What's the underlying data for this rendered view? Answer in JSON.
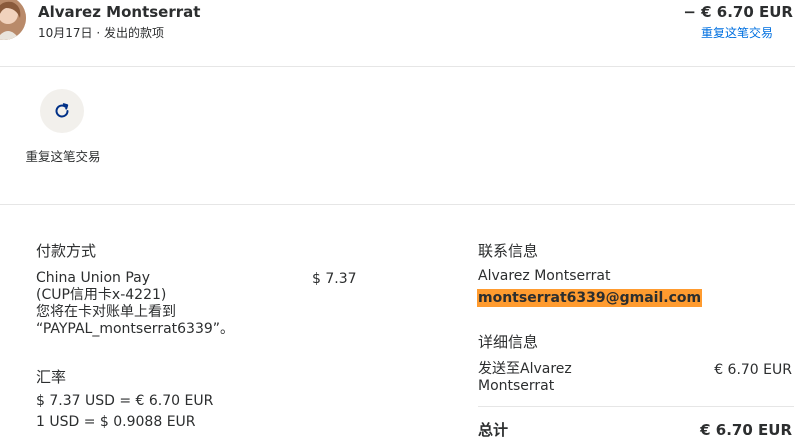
{
  "header": {
    "payee": "Alvarez Montserrat",
    "date_type": "10月17日 · 发出的款项",
    "amount": "− € 6.70 EUR",
    "repeat_link": "重复这笔交易"
  },
  "actions": {
    "repeat_label": "重复这笔交易"
  },
  "payment": {
    "heading": "付款方式",
    "method_lines": [
      "China Union Pay",
      "(CUP信用卡x-4221)",
      "您将在卡对账单上看到",
      "“PAYPAL_montserrat6339”。"
    ],
    "amount": "$ 7.37"
  },
  "exchange": {
    "heading": "汇率",
    "line1": "$ 7.37 USD = € 6.70 EUR",
    "line2": "1 USD = $ 0.9088 EUR"
  },
  "contact": {
    "heading": "联系信息",
    "name": "Alvarez Montserrat",
    "email": "montserrat6339@gmail.com"
  },
  "details": {
    "heading": "详细信息",
    "sent_to_lines": [
      "发送至Alvarez",
      "Montserrat"
    ],
    "sent_amount": "€ 6.70 EUR",
    "total_label": "总计",
    "total_amount": "€ 6.70 EUR"
  },
  "colors": {
    "link": "#0070e0",
    "highlight": "#ff9b2f",
    "divider": "#e6e6e6"
  }
}
